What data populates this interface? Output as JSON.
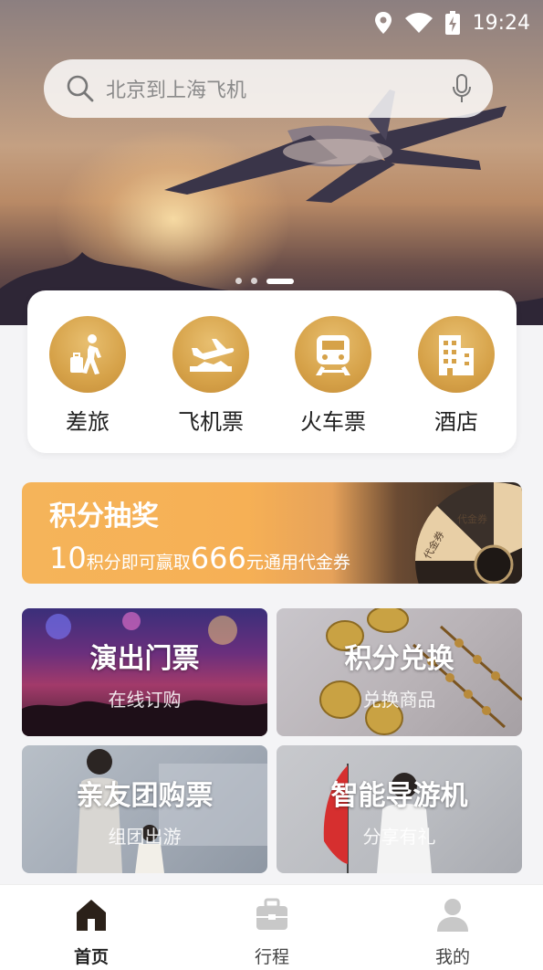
{
  "status_bar": {
    "time": "19:24"
  },
  "search": {
    "placeholder": "北京到上海飞机"
  },
  "banner": {
    "slide_count": 3,
    "active_slide": 3
  },
  "categories": [
    {
      "label": "差旅",
      "icon": "traveler-icon"
    },
    {
      "label": "飞机票",
      "icon": "plane-icon"
    },
    {
      "label": "火车票",
      "icon": "train-icon"
    },
    {
      "label": "酒店",
      "icon": "building-icon"
    }
  ],
  "lottery": {
    "title": "积分抽奖",
    "subtitle_num1": "10",
    "subtitle_text1": "积分即可赢取",
    "subtitle_num2": "666",
    "subtitle_text2": "元通用代金券",
    "wheel_label": "代金券"
  },
  "tiles": [
    {
      "title": "演出门票",
      "subtitle": "在线订购"
    },
    {
      "title": "积分兑换",
      "subtitle": "兑换商品"
    },
    {
      "title": "亲友团购票",
      "subtitle": "组团出游"
    },
    {
      "title": "智能导游机",
      "subtitle": "分享有礼"
    }
  ],
  "tabbar": [
    {
      "label": "首页",
      "icon": "home-icon",
      "active": true
    },
    {
      "label": "行程",
      "icon": "briefcase-icon",
      "active": false
    },
    {
      "label": "我的",
      "icon": "person-icon",
      "active": false
    }
  ],
  "colors": {
    "accent": "#d6a249",
    "tab_active": "#2b2119",
    "tab_inactive": "#c8c8c8"
  }
}
